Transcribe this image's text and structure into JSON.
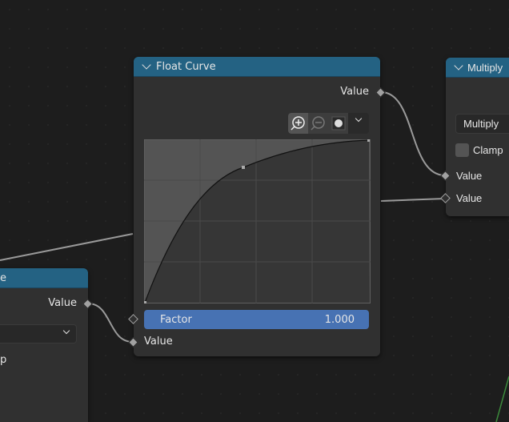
{
  "float_curve_node": {
    "title": "Float Curve",
    "output_label": "Value",
    "toolbar": {
      "zoom_in": "zoom-in-icon",
      "zoom_out": "zoom-out-icon",
      "clip": "clipping-icon",
      "menu": "chevron-down-icon"
    },
    "factor_label": "Factor",
    "factor_value": "1.000",
    "input_label": "Value",
    "curve_points": [
      [
        0,
        0
      ],
      [
        0.44,
        0.83
      ],
      [
        1,
        1
      ]
    ],
    "accent": "#4772b3"
  },
  "left_node": {
    "title_fragment": "e",
    "output_label": "Value",
    "clamp_fragment": "p"
  },
  "multiply_node": {
    "title": "Multiply",
    "operation": "Multiply",
    "clamp_label": "Clamp",
    "input1_label": "Value",
    "input2_label": "Value"
  },
  "colors": {
    "header": "#246283",
    "node_bg": "#303030",
    "canvas": "#1d1d1d"
  }
}
